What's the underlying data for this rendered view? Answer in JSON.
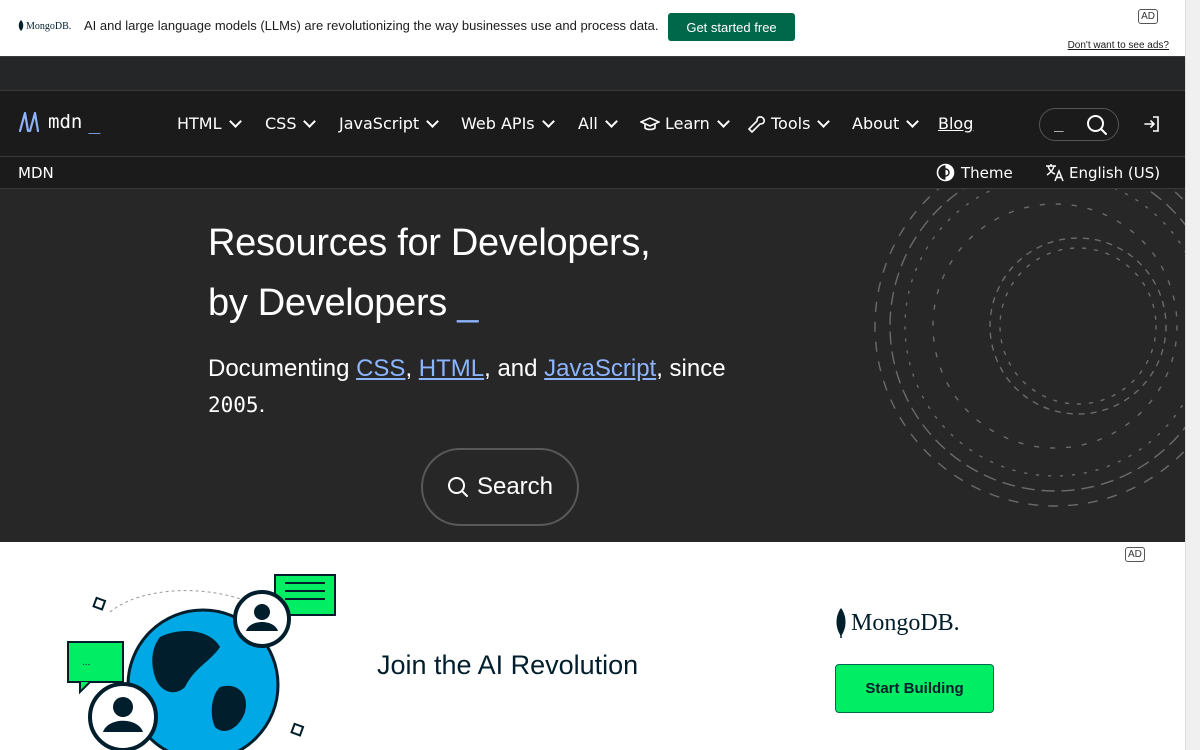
{
  "top_ad": {
    "brand": "MongoDB.",
    "message": "AI and large language models (LLMs) are revolutionizing the way businesses use and process data.",
    "cta": "Get started free",
    "badge": "AD",
    "hide_link": "Don't want to see ads?"
  },
  "nav": {
    "logo_text": "mdn",
    "logo_cursor": "_",
    "items": [
      {
        "label": "HTML",
        "icon": ""
      },
      {
        "label": "CSS",
        "icon": ""
      },
      {
        "label": "JavaScript",
        "icon": ""
      },
      {
        "label": "Web APIs",
        "icon": ""
      },
      {
        "label": "All",
        "icon": ""
      },
      {
        "label": "Learn",
        "icon": "graduation-cap-icon"
      },
      {
        "label": "Tools",
        "icon": "wrench-icon"
      },
      {
        "label": "About",
        "icon": ""
      }
    ],
    "blog": "Blog",
    "search_cursor": "_"
  },
  "subbar": {
    "breadcrumb": "MDN",
    "theme": "Theme",
    "language": "English (US)"
  },
  "hero": {
    "title_line1": "Resources for Developers,",
    "title_line2": "by Developers",
    "title_cursor": "_",
    "sub_prefix": "Documenting ",
    "link_css": "CSS",
    "sep1": ", ",
    "link_html": "HTML",
    "sep2": ", and ",
    "link_js": "JavaScript",
    "sub_suffix": ", since",
    "year": "2005",
    "year_suffix": ".",
    "search_label": "Search"
  },
  "bottom_ad": {
    "badge": "AD",
    "headline": "Join the AI Revolution",
    "brand": "MongoDB.",
    "cta": "Start Building"
  },
  "colors": {
    "accent": "#8cb4ff",
    "background": "#1b1b1b",
    "hero_bg": "#272728",
    "mongo_green": "#00ed64",
    "mongo_dark_green": "#00684a"
  }
}
